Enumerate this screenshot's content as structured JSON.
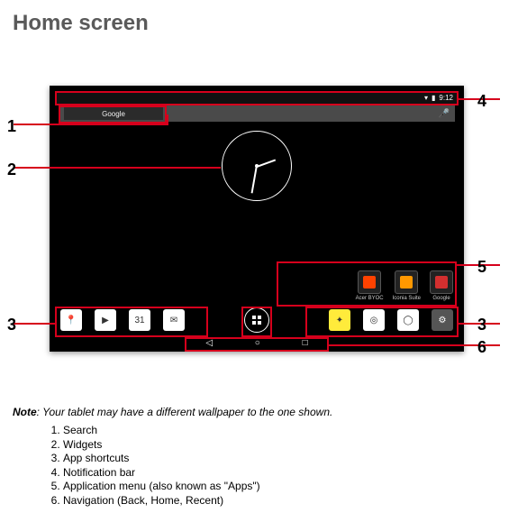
{
  "title": "Home screen",
  "statusbar": {
    "wifi": "▾",
    "batt": "▮",
    "time": "9:12"
  },
  "search": {
    "brand": "Google"
  },
  "folders": [
    {
      "label": "Acer BYOC",
      "color": "#ff4200"
    },
    {
      "label": "Iconia Suite",
      "color": "#ff9800"
    },
    {
      "label": "Google",
      "color": "#d32f2f"
    }
  ],
  "dock_left": [
    {
      "name": "maps-icon",
      "bg": "#fff",
      "glyph": "📍"
    },
    {
      "name": "play-store-icon",
      "bg": "#fff",
      "glyph": "▶"
    },
    {
      "name": "calendar-icon",
      "bg": "#fff",
      "glyph": "31"
    },
    {
      "name": "gmail-icon",
      "bg": "#fff",
      "glyph": "✉"
    }
  ],
  "dock_right": [
    {
      "name": "game-icon",
      "bg": "#ffeb3b",
      "glyph": "✦"
    },
    {
      "name": "camera-icon",
      "bg": "#fff",
      "glyph": "◎"
    },
    {
      "name": "chrome-icon",
      "bg": "#fff",
      "glyph": "◯"
    },
    {
      "name": "settings-icon",
      "bg": "#555",
      "glyph": "⚙"
    }
  ],
  "nav": {
    "back": "◁",
    "home": "○",
    "recent": "□"
  },
  "callout_nums": {
    "n1": "1",
    "n2": "2",
    "n3l": "3",
    "n3r": "3",
    "n4": "4",
    "n5": "5",
    "n6": "6"
  },
  "note": {
    "boldword": "Note",
    "text": ": Your tablet may have a different wallpaper to the one shown."
  },
  "legend": [
    "Search",
    "Widgets",
    "App shortcuts",
    "Notification bar",
    "Application menu (also known as \"Apps\")",
    "Navigation (Back, Home, Recent)"
  ]
}
